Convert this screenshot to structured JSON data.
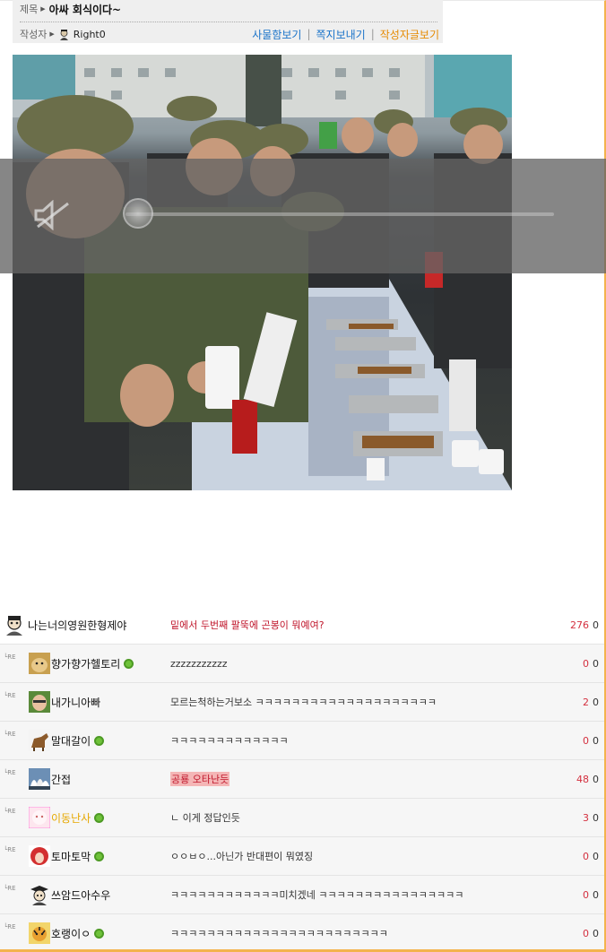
{
  "header": {
    "title_label": "제목",
    "title": "아싸 회식이다~",
    "author_label": "작성자",
    "author": "Right0",
    "actions": [
      "사물함보기",
      "쪽지보내기",
      "작성자글보기"
    ]
  },
  "colors": {
    "link": "#1a73c9",
    "orange": "#e68a00",
    "vote_up": "#d4303f",
    "accent_border": "#f3b34d"
  },
  "media_player": {
    "volume_icon": "speaker-muted-icon",
    "progress": 0.0
  },
  "comments": [
    {
      "nick": "나는너의영원한형제야",
      "avatar": "avatar-cartoon-icon",
      "reply": false,
      "online": false,
      "text": "밑에서 두번째 팔뚝에 곤봉이 뭐예여?",
      "text_style": "red",
      "up": "276",
      "down": "0"
    },
    {
      "nick": "향가향가헬토리",
      "avatar": "avatar-hamster-icon",
      "reply": true,
      "online": true,
      "text": "zzzzzzzzzzz",
      "text_style": "normal",
      "up": "0",
      "down": "0"
    },
    {
      "nick": "내가니아빠",
      "avatar": "avatar-face-icon",
      "reply": true,
      "online": false,
      "text": "모르는척하는거보소 ㅋㅋㅋㅋㅋㅋㅋㅋㅋㅋㅋㅋㅋㅋㅋㅋㅋㅋㅋㅋ",
      "text_style": "normal",
      "up": "2",
      "down": "0"
    },
    {
      "nick": "말대갈이",
      "avatar": "avatar-horse-icon",
      "reply": true,
      "online": true,
      "text": "ㅋㅋㅋㅋㅋㅋㅋㅋㅋㅋㅋㅋㅋ",
      "text_style": "normal",
      "up": "0",
      "down": "0"
    },
    {
      "nick": "간접",
      "avatar": "avatar-opera-house-icon",
      "reply": true,
      "online": false,
      "text": "공룡 오타난듯",
      "text_style": "highlight",
      "up": "48",
      "down": "0"
    },
    {
      "nick": "이동난사",
      "avatar": "avatar-pink-icon",
      "reply": true,
      "online": true,
      "text": "ㄴ 이게 정답인듯",
      "text_style": "normal",
      "up": "3",
      "down": "0",
      "nick_style": "highlight"
    },
    {
      "nick": "토마토막",
      "avatar": "avatar-red-hair-icon",
      "reply": true,
      "online": true,
      "text": "ㅇㅇㅂㅇ...아닌가 반대편이 뭐였징",
      "text_style": "normal",
      "up": "0",
      "down": "0"
    },
    {
      "nick": "쓰암드아수우",
      "avatar": "avatar-graduate-icon",
      "reply": true,
      "online": false,
      "text": "ㅋㅋㅋㅋㅋㅋㅋㅋㅋㅋㅋㅋ미치겠네 ㅋㅋㅋㅋㅋㅋㅋㅋㅋㅋㅋㅋㅋㅋㅋㅋ",
      "text_style": "normal",
      "up": "0",
      "down": "0"
    },
    {
      "nick": "호랭이ㅇ",
      "avatar": "avatar-tiger-icon",
      "reply": true,
      "online": true,
      "text": "ㅋㅋㅋㅋㅋㅋㅋㅋㅋㅋㅋㅋㅋㅋㅋㅋㅋㅋㅋㅋㅋㅋㅋㅋ",
      "text_style": "normal",
      "up": "0",
      "down": "0"
    }
  ]
}
